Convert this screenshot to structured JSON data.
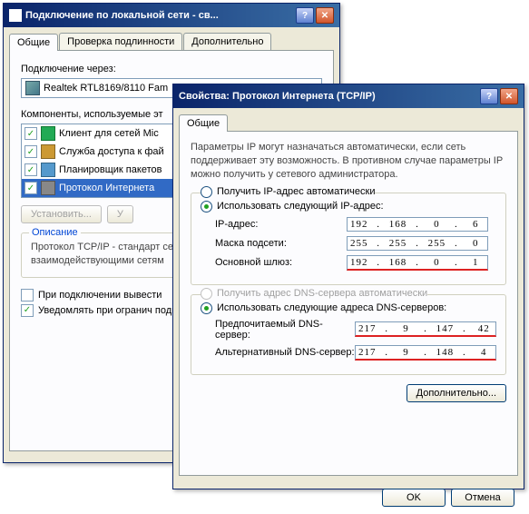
{
  "win1": {
    "title": "Подключение по локальной сети - св...",
    "tabs": {
      "general": "Общие",
      "auth": "Проверка подлинности",
      "advanced": "Дополнительно"
    },
    "connect_via_label": "Подключение через:",
    "adapter": "Realtek RTL8169/8110 Fam",
    "components_label": "Компоненты, используемые эт",
    "items": [
      {
        "text": "Клиент для сетей Mic"
      },
      {
        "text": "Служба доступа к фай"
      },
      {
        "text": "Планировщик пакетов"
      },
      {
        "text": "Протокол Интернета"
      }
    ],
    "btn_install": "Установить...",
    "btn_uninstall": "У",
    "desc_title": "Описание",
    "desc_text": "Протокол TCP/IP - стандарт сетей, обеспечивающий свя взаимодействующими сетям",
    "chk_icon": "При подключении вывести",
    "chk_notify": "Уведомлять при огранич подключении"
  },
  "win2": {
    "title": "Свойства: Протокол Интернета (TCP/IP)",
    "tab_general": "Общие",
    "intro": "Параметры IP могут назначаться автоматически, если сеть поддерживает эту возможность. В противном случае параметры IP можно получить у сетевого администратора.",
    "radio_auto_ip": "Получить IP-адрес автоматически",
    "radio_manual_ip": "Использовать следующий IP-адрес:",
    "lbl_ip": "IP-адрес:",
    "lbl_mask": "Маска подсети:",
    "lbl_gw": "Основной шлюз:",
    "ip": [
      "192",
      "168",
      "0",
      "6"
    ],
    "mask": [
      "255",
      "255",
      "255",
      "0"
    ],
    "gw": [
      "192",
      "168",
      "0",
      "1"
    ],
    "radio_auto_dns": "Получить адрес DNS-сервера автоматически",
    "radio_manual_dns": "Использовать следующие адреса DNS-серверов:",
    "lbl_dns1": "Предпочитаемый DNS-сервер:",
    "lbl_dns2": "Альтернативный DNS-сервер:",
    "dns1": [
      "217",
      "9",
      "147",
      "42"
    ],
    "dns2": [
      "217",
      "9",
      "148",
      "4"
    ],
    "btn_adv": "Дополнительно...",
    "btn_ok": "OK",
    "btn_cancel": "Отмена"
  }
}
